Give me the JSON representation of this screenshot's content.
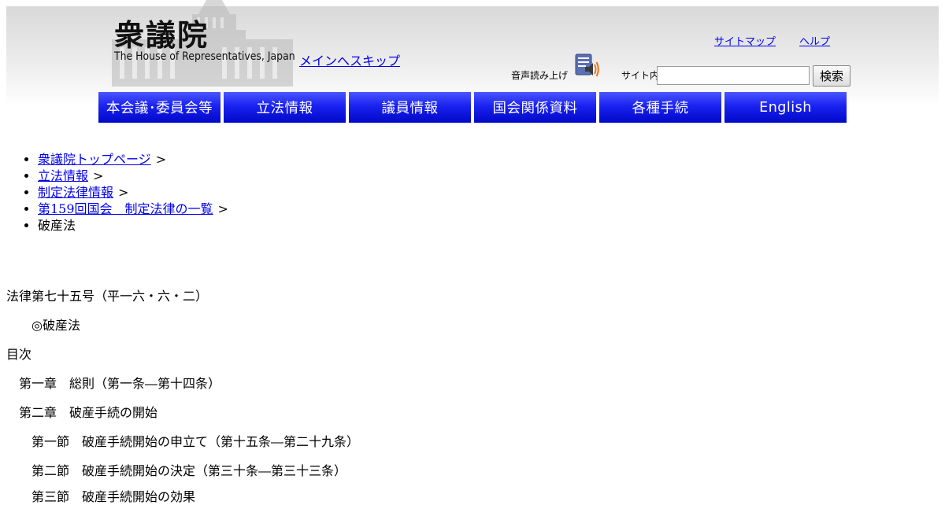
{
  "header": {
    "logo_kanji": "衆議院",
    "logo_english": "The House of Representatives, Japan",
    "skip_link": "メインへスキップ",
    "sitemap_link": "サイトマップ",
    "help_link": "ヘルプ",
    "voice_label": "音声読み上げ",
    "site_search_label": "サイト内検索",
    "search_value": "",
    "search_button": "検索"
  },
  "nav": {
    "items": [
      "本会議･委員会等",
      "立法情報",
      "議員情報",
      "国会関係資料",
      "各種手続",
      "English"
    ]
  },
  "breadcrumb": {
    "items": [
      {
        "label": "衆議院トップページ",
        "link": true
      },
      {
        "label": "立法情報",
        "link": true
      },
      {
        "label": "制定法律情報",
        "link": true
      },
      {
        "label": "第159回国会　制定法律の一覧",
        "link": true
      },
      {
        "label": "破産法",
        "link": false
      }
    ],
    "separator": ">"
  },
  "content": {
    "law_number": "法律第七十五号（平一六・六・二）",
    "law_title": "◎破産法",
    "toc_heading": "目次",
    "toc": [
      "第一章　総則（第一条―第十四条）",
      "第二章　破産手続の開始",
      "第一節　破産手続開始の申立て（第十五条―第二十九条）",
      "第二節　破産手続開始の決定（第三十条―第三十三条）",
      "第三節　破産手続開始の効果"
    ]
  }
}
